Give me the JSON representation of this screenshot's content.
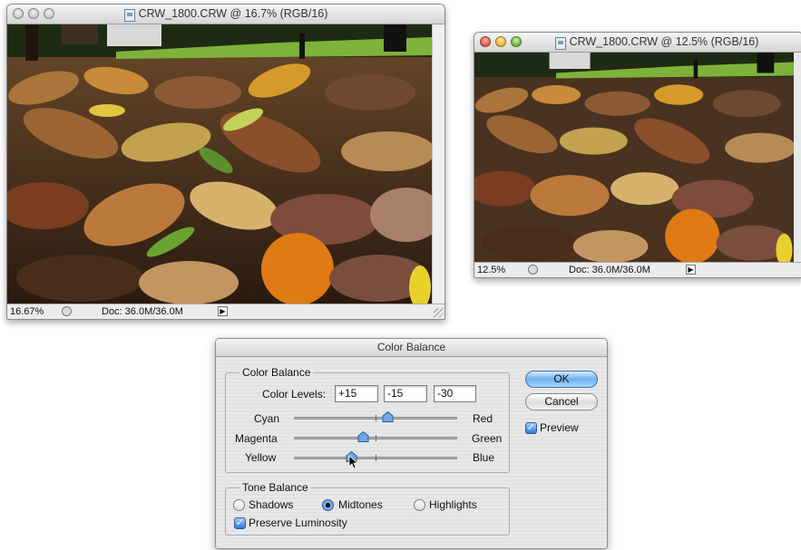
{
  "window_large": {
    "title": "CRW_1800.CRW @ 16.7% (RGB/16)",
    "zoom": "16.67%",
    "doc_info": "Doc: 36.0M/36.0M"
  },
  "window_small": {
    "title": "CRW_1800.CRW @ 12.5% (RGB/16)",
    "zoom": "12.5%",
    "doc_info": "Doc: 36.0M/36.0M"
  },
  "dialog": {
    "title": "Color Balance",
    "color_balance_group": {
      "title": "Color Balance",
      "levels_label": "Color Levels:",
      "levels": [
        "+15",
        "-15",
        "-30"
      ],
      "sliders": [
        {
          "left": "Cyan",
          "right": "Red",
          "value": 15
        },
        {
          "left": "Magenta",
          "right": "Green",
          "value": -15
        },
        {
          "left": "Yellow",
          "right": "Blue",
          "value": -30
        }
      ]
    },
    "tone_balance_group": {
      "title": "Tone Balance",
      "shadows": "Shadows",
      "midtones": "Midtones",
      "highlights": "Highlights",
      "selected": "Midtones",
      "preserve_luminosity": "Preserve Luminosity",
      "preserve_luminosity_checked": true
    },
    "buttons": {
      "ok": "OK",
      "cancel": "Cancel"
    },
    "preview_label": "Preview",
    "preview_checked": true
  },
  "icons": {
    "close": "close-light-icon",
    "minimize": "minimize-light-icon",
    "zoom": "zoom-light-icon",
    "document": "document-icon",
    "status_menu": "status-menu-icon",
    "status_arrow": "triangle-right-icon",
    "slider_knob": "slider-knob-icon",
    "pointer": "arrow-cursor-icon",
    "resize": "resize-grip-icon"
  }
}
